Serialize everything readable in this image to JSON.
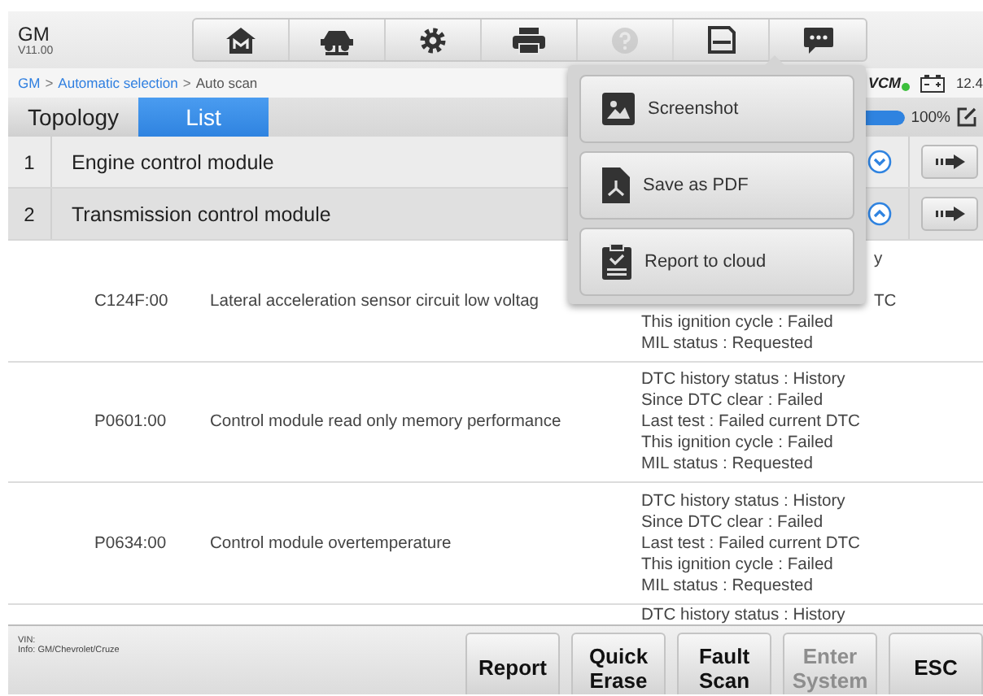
{
  "header": {
    "brand": "GM",
    "version": "V11.00",
    "tools": [
      {
        "kind": "home",
        "disabled": false
      },
      {
        "kind": "lift",
        "disabled": false
      },
      {
        "kind": "settings",
        "disabled": false
      },
      {
        "kind": "print",
        "disabled": false
      },
      {
        "kind": "help",
        "disabled": true
      },
      {
        "kind": "save",
        "disabled": false
      },
      {
        "kind": "chat",
        "disabled": false
      }
    ]
  },
  "breadcrumb": {
    "separator": ">",
    "items": [
      {
        "label": "GM",
        "link": true
      },
      {
        "label": "Automatic selection",
        "link": true
      },
      {
        "label": "Auto scan",
        "link": false
      }
    ]
  },
  "status": {
    "vci": "VCM",
    "connected": true,
    "voltage": "12.4"
  },
  "tabs": [
    {
      "label": "Topology",
      "selected": false
    },
    {
      "label": "List",
      "selected": true
    }
  ],
  "progress": {
    "level": 1,
    "reading": "100%"
  },
  "modules": [
    {
      "number": "1",
      "name": "Engine control module",
      "expanded": false
    },
    {
      "number": "2",
      "name": "Transmission control module",
      "expanded": true
    }
  ],
  "dtcs": [
    {
      "code": "C124F:00",
      "description": "Lateral acceleration sensor circuit low voltag",
      "status": [
        {
          "text": "y",
          "kind": "tail"
        },
        {
          "text": "TC",
          "kind": "tail"
        },
        {
          "text": "This ignition cycle : Failed",
          "kind": "line"
        },
        {
          "text": "MIL status : Requested",
          "kind": "line"
        }
      ]
    },
    {
      "code": "P0601:00",
      "description": "Control module read only memory performance",
      "status": [
        {
          "text": "DTC history status : History",
          "kind": "line"
        },
        {
          "text": "Since DTC clear : Failed",
          "kind": "line"
        },
        {
          "text": "Last test : Failed current DTC",
          "kind": "line"
        },
        {
          "text": "This ignition cycle : Failed",
          "kind": "line"
        },
        {
          "text": "MIL status : Requested",
          "kind": "line"
        }
      ]
    },
    {
      "code": "P0634:00",
      "description": "Control module overtemperature",
      "status": [
        {
          "text": "DTC history status : History",
          "kind": "line"
        },
        {
          "text": "Since DTC clear : Failed",
          "kind": "line"
        },
        {
          "text": "Last test : Failed current DTC",
          "kind": "line"
        },
        {
          "text": "This ignition cycle : Failed",
          "kind": "line"
        },
        {
          "text": "MIL status : Requested",
          "kind": "line"
        }
      ]
    },
    {
      "status": [
        {
          "text": "DTC history status : History",
          "kind": "line"
        }
      ]
    }
  ],
  "popup": {
    "items": [
      {
        "label": "Screenshot",
        "kind": "image"
      },
      {
        "label": "Save as PDF",
        "kind": "pdf"
      },
      {
        "label": "Report to cloud",
        "kind": "cloud"
      }
    ]
  },
  "footer": {
    "vin": "VIN:",
    "info": "Info: GM/Chevrolet/Cruze",
    "buttons": [
      {
        "label": "Report",
        "disabled": false
      },
      {
        "label": "Quick Erase",
        "disabled": false
      },
      {
        "label": "Fault Scan",
        "disabled": false
      },
      {
        "label": "Enter System",
        "disabled": true
      },
      {
        "label": "ESC",
        "disabled": false
      }
    ]
  }
}
